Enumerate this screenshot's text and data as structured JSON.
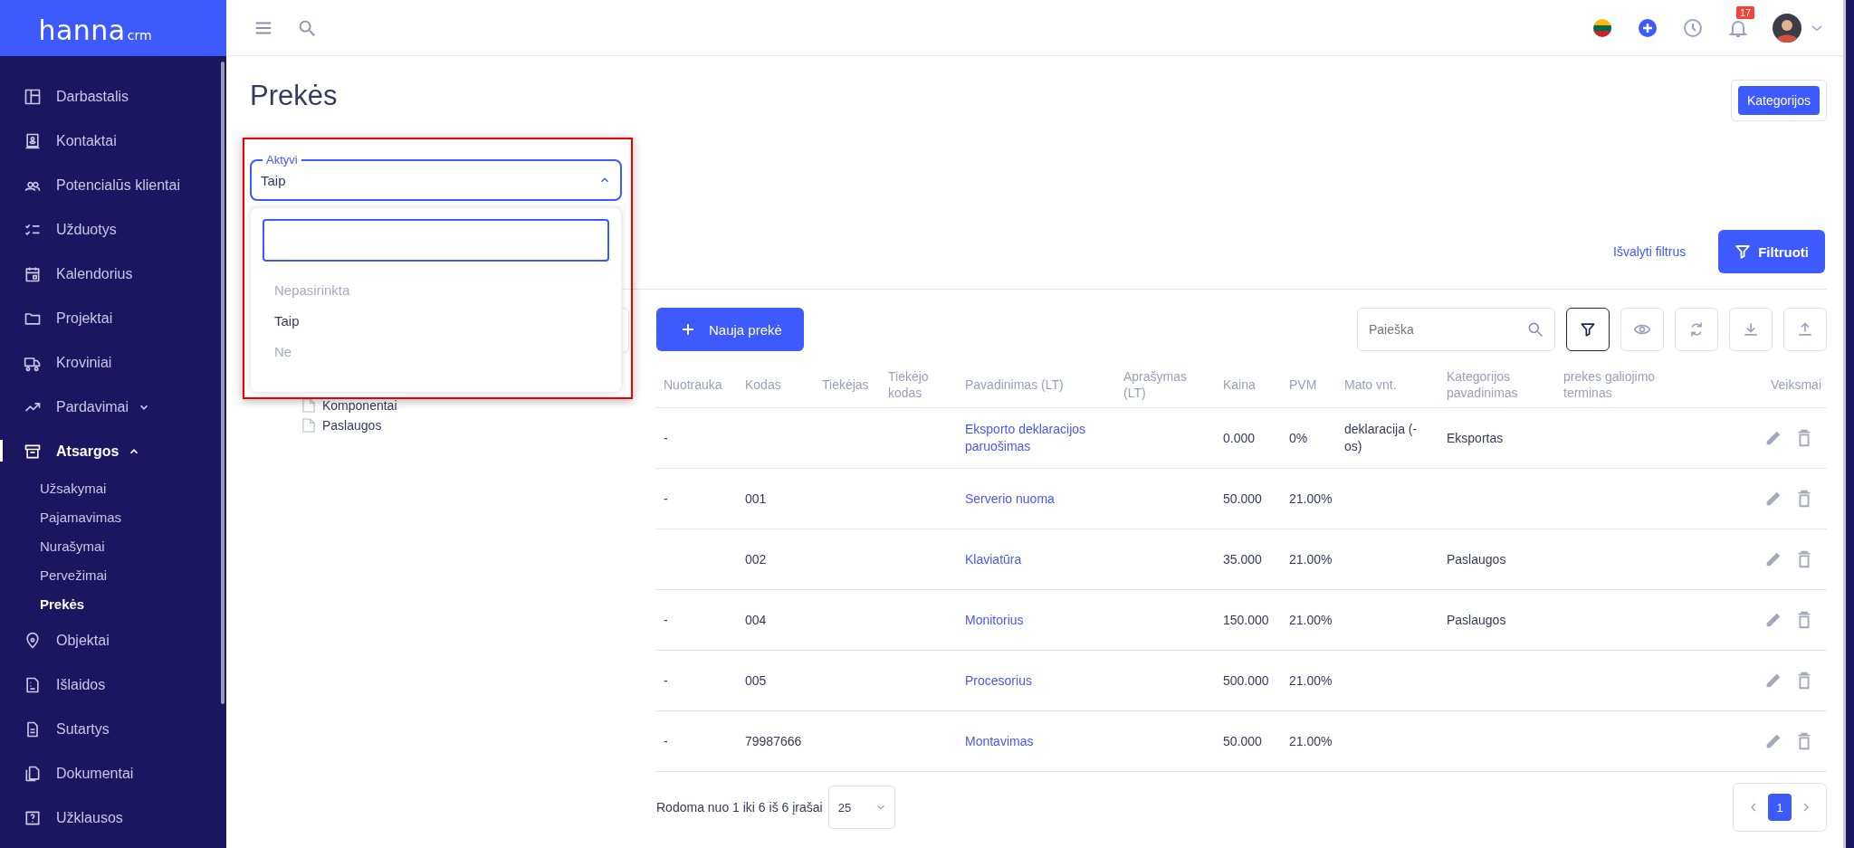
{
  "sidebar": {
    "logo": {
      "name": "hanna",
      "suffix": "crm"
    },
    "items": [
      {
        "label": "Darbastalis",
        "selected": false
      },
      {
        "label": "Kontaktai",
        "selected": false
      },
      {
        "label": "Potencialūs klientai",
        "selected": false
      },
      {
        "label": "Užduotys",
        "selected": false
      },
      {
        "label": "Kalendorius",
        "selected": false
      },
      {
        "label": "Projektai",
        "selected": false
      },
      {
        "label": "Kroviniai",
        "selected": false
      },
      {
        "label": "Pardavimai",
        "selected": false,
        "expanded": false
      },
      {
        "label": "Atsargos",
        "selected": true,
        "expanded": true,
        "children": [
          {
            "label": "Užsakymai",
            "selected": false
          },
          {
            "label": "Pajamavimas",
            "selected": false
          },
          {
            "label": "Nurašymai",
            "selected": false
          },
          {
            "label": "Pervežimai",
            "selected": false
          },
          {
            "label": "Prekės",
            "selected": true
          }
        ]
      },
      {
        "label": "Objektai",
        "selected": false
      },
      {
        "label": "Išlaidos",
        "selected": false
      },
      {
        "label": "Sutartys",
        "selected": false
      },
      {
        "label": "Dokumentai",
        "selected": false
      },
      {
        "label": "Užklausos",
        "selected": false
      }
    ]
  },
  "topbar": {
    "notifications": "17"
  },
  "page": {
    "title": "Prekės",
    "categories_button": "Kategorijos"
  },
  "filters": {
    "select": {
      "label": "Aktyvi",
      "value": "Taip",
      "open": true,
      "options": [
        {
          "label": "Nepasirinkta",
          "selected": false
        },
        {
          "label": "Taip",
          "selected": true
        },
        {
          "label": "Ne",
          "selected": false
        }
      ]
    },
    "clear_link": "Išvalyti filtrus",
    "apply_button": "Filtruoti"
  },
  "tree": {
    "items": [
      "Komponentai",
      "Paslaugos"
    ]
  },
  "toolbar": {
    "new_button": "Nauja prekė",
    "search": {
      "placeholder": "Paieška"
    },
    "filter_active": true
  },
  "table": {
    "columns": [
      "Nuotrauka",
      "Kodas",
      "Tiekėjas",
      "Tiekėjo kodas",
      "Pavadinimas (LT)",
      "Aprašymas (LT)",
      "Kaina",
      "PVM",
      "Mato vnt.",
      "Kategorijos pavadinimas",
      "prekes galiojimo terminas",
      "Veiksmai"
    ],
    "rows": [
      [
        "-",
        "",
        "",
        "",
        "Eksporto deklaracijos paruošimas",
        "",
        "0.000",
        "0%",
        "deklaracija (-os)",
        "Eksportas",
        ""
      ],
      [
        "-",
        "001",
        "",
        "",
        "Serverio nuoma",
        "",
        "50.000",
        "21.00%",
        "",
        "",
        ""
      ],
      [
        "",
        "002",
        "",
        "",
        "Klaviatūra",
        "",
        "35.000",
        "21.00%",
        "",
        "Paslaugos",
        ""
      ],
      [
        "-",
        "004",
        "",
        "",
        "Monitorius",
        "",
        "150.000",
        "21.00%",
        "",
        "Paslaugos",
        ""
      ],
      [
        "-",
        "005",
        "",
        "",
        "Procesorius",
        "",
        "500.000",
        "21.00%",
        "",
        "",
        ""
      ],
      [
        "-",
        "79987666",
        "",
        "",
        "Montavimas",
        "",
        "50.000",
        "21.00%",
        "",
        "",
        ""
      ]
    ]
  },
  "footer": {
    "summary": "Rodoma nuo 1 iki 6 iš 6 įrašai",
    "page_size": "25",
    "pages": [
      {
        "label": "1",
        "selected": true
      }
    ]
  }
}
